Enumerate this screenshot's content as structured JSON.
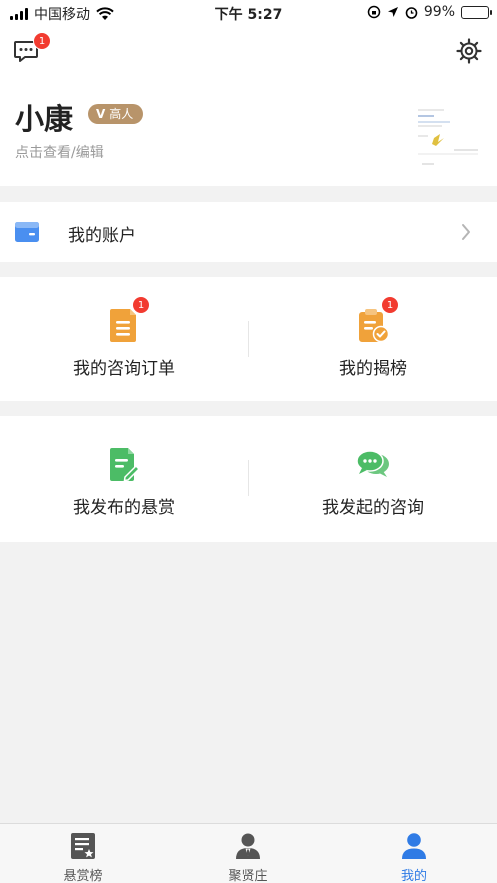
{
  "status_bar": {
    "carrier": "中国移动",
    "time": "下午 5:27",
    "battery": "99%"
  },
  "header": {
    "message_badge": "1",
    "user_name": "小康",
    "vip_label": "高人",
    "edit_hint": "点击查看/编辑"
  },
  "account": {
    "label": "我的账户"
  },
  "orders_card": {
    "left_label": "我的咨询订单",
    "left_badge": "1",
    "right_label": "我的揭榜",
    "right_badge": "1"
  },
  "posts_card": {
    "left_label": "我发布的悬赏",
    "right_label": "我发起的咨询"
  },
  "tabbar": {
    "tabs": [
      {
        "label": "悬赏榜",
        "icon": "list-star-icon"
      },
      {
        "label": "聚贤庄",
        "icon": "person-suit-icon"
      },
      {
        "label": "我的",
        "icon": "person-icon"
      }
    ],
    "active_color": "#2f7be5"
  },
  "colors": {
    "vip": "#b8946a",
    "badge": "#f23b30",
    "orange_icon": "#f0a23a",
    "green_icon": "#4cbc66",
    "wallet": "#4a8ff0"
  }
}
